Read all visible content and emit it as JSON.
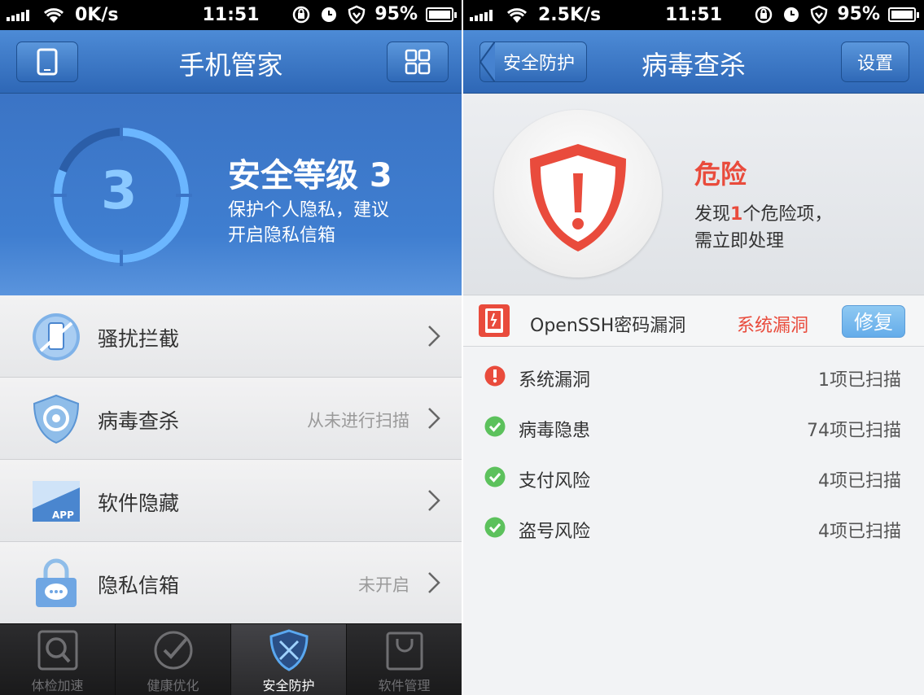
{
  "left_screen": {
    "status_bar": {
      "speed": "0K/s",
      "time": "11:51",
      "battery": "95%"
    },
    "nav": {
      "title": "手机管家"
    },
    "hero": {
      "level_text": "安全等级 3",
      "level_number": "3",
      "desc_line1": "保护个人隐私，建议",
      "desc_line2": "开启隐私信箱"
    },
    "list": [
      {
        "label": "骚扰拦截",
        "status": ""
      },
      {
        "label": "病毒查杀",
        "status": "从未进行扫描"
      },
      {
        "label": "软件隐藏",
        "status": ""
      },
      {
        "label": "隐私信箱",
        "status": "未开启"
      }
    ],
    "app_icon_text": "APP",
    "tabs": [
      {
        "label": "体检加速",
        "active": false
      },
      {
        "label": "健康优化",
        "active": false
      },
      {
        "label": "安全防护",
        "active": true
      },
      {
        "label": "软件管理",
        "active": false
      }
    ]
  },
  "right_screen": {
    "status_bar": {
      "speed": "2.5K/s",
      "time": "11:51",
      "battery": "95%"
    },
    "nav": {
      "back_label": "安全防护",
      "title": "病毒查杀",
      "settings_label": "设置"
    },
    "hero": {
      "danger": "危险",
      "desc_prefix": "发现",
      "desc_count": "1",
      "desc_suffix": "个危险项，",
      "desc_line2": "需立即处理"
    },
    "vulnerability": {
      "name": "OpenSSH密码漏洞",
      "type": "系统漏洞",
      "fix_label": "修复"
    },
    "scan_results": [
      {
        "name": "系统漏洞",
        "count": "1项已扫描",
        "status": "warning"
      },
      {
        "name": "病毒隐患",
        "count": "74项已扫描",
        "status": "ok"
      },
      {
        "name": "支付风险",
        "count": "4项已扫描",
        "status": "ok"
      },
      {
        "name": "盗号风险",
        "count": "4项已扫描",
        "status": "ok"
      }
    ]
  },
  "colors": {
    "nav_blue": "#3a78c9",
    "danger_red": "#e94b3c",
    "ok_green": "#5cc15c",
    "ring_blue": "#6bb6ff"
  }
}
